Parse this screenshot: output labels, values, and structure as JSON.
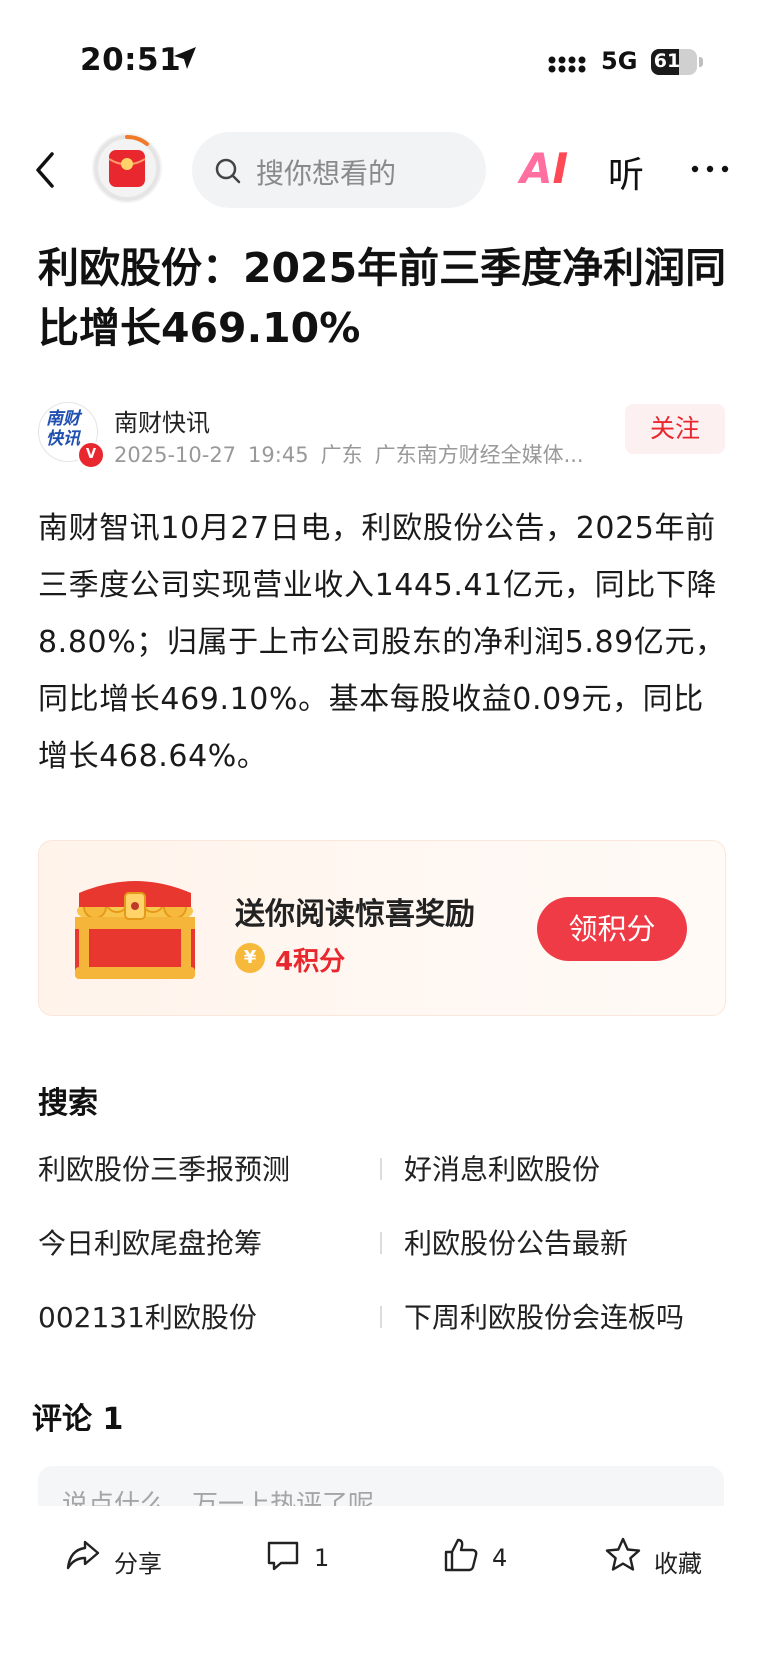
{
  "status_bar": {
    "time": "20:51",
    "network": "5G",
    "battery_level": "61",
    "battery_fraction": 0.61
  },
  "nav": {
    "search_placeholder": "搜你想看的",
    "ai_label_a": "A",
    "ai_label_i": "I",
    "listen_label": "听"
  },
  "article": {
    "title": "利欧股份：2025年前三季度净利润同比增长469.10%",
    "author": {
      "name": "南财快讯",
      "logo_text": "南财快讯",
      "verified_mark": "V",
      "date": "2025-10-27",
      "time": "19:45",
      "region": "广东",
      "source": "广东南方财经全媒体..."
    },
    "follow_label": "关注",
    "body": "南财智讯10月27日电，利欧股份公告，2025年前三季度公司实现营业收入1445.41亿元，同比下降8.80%；归属于上市公司股东的净利润5.89亿元，同比增长469.10%。基本每股收益0.09元，同比增长468.64%。"
  },
  "reward": {
    "title": "送你阅读惊喜奖励",
    "coin_symbol": "¥",
    "points": "4积分",
    "button": "领积分"
  },
  "search_section": {
    "heading": "搜索",
    "links": [
      "利欧股份三季报预测",
      "好消息利欧股份",
      "今日利欧尾盘抢筹",
      "利欧股份公告最新",
      "002131利欧股份",
      "下周利欧股份会连板吗"
    ]
  },
  "comments": {
    "heading": "评论 1",
    "input_placeholder": "说点什么，万一上热评了呢"
  },
  "bottom_bar": {
    "share": "分享",
    "comments_count": "1",
    "likes_count": "4",
    "favorite": "收藏"
  }
}
